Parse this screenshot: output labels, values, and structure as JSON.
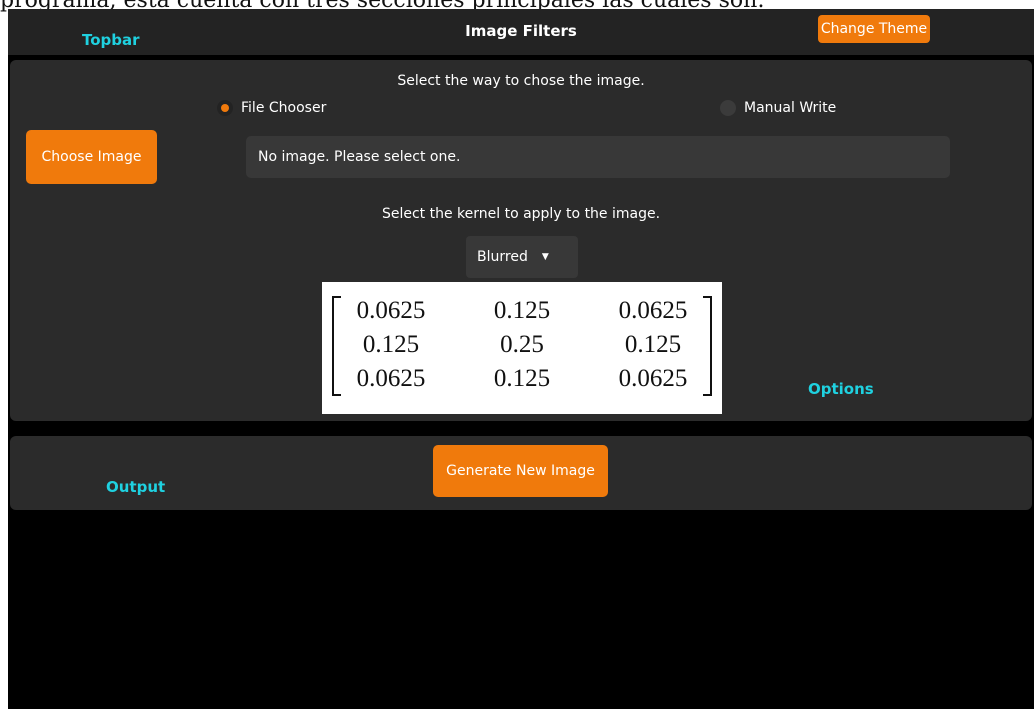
{
  "document": {
    "fragment": "programa, esta cuenta con tres secciones principales las cuales son:"
  },
  "topbar": {
    "label": "Topbar",
    "title": "Image Filters",
    "theme_button": "Change Theme"
  },
  "options": {
    "prompt": "Select the way to chose the image.",
    "radio_file": "File Chooser",
    "radio_manual": "Manual Write",
    "selected_mode": "File Chooser",
    "choose_button": "Choose Image",
    "path_text": "No image. Please select one.",
    "kernel_prompt": "Select the kernel to apply to the image.",
    "kernel_selected": "Blurred",
    "matrix": [
      [
        "0.0625",
        "0.125",
        "0.0625"
      ],
      [
        "0.125",
        "0.25",
        "0.125"
      ],
      [
        "0.0625",
        "0.125",
        "0.0625"
      ]
    ],
    "label": "Options"
  },
  "output": {
    "label": "Output",
    "generate_button": "Generate New Image"
  },
  "colors": {
    "accent": "#f07a0c",
    "label_cyan": "#1fd1e0",
    "panel": "#2b2b2b",
    "background": "#000000"
  },
  "icons": {
    "dropdown": "caret-down-icon",
    "radio": "radio-icon"
  }
}
